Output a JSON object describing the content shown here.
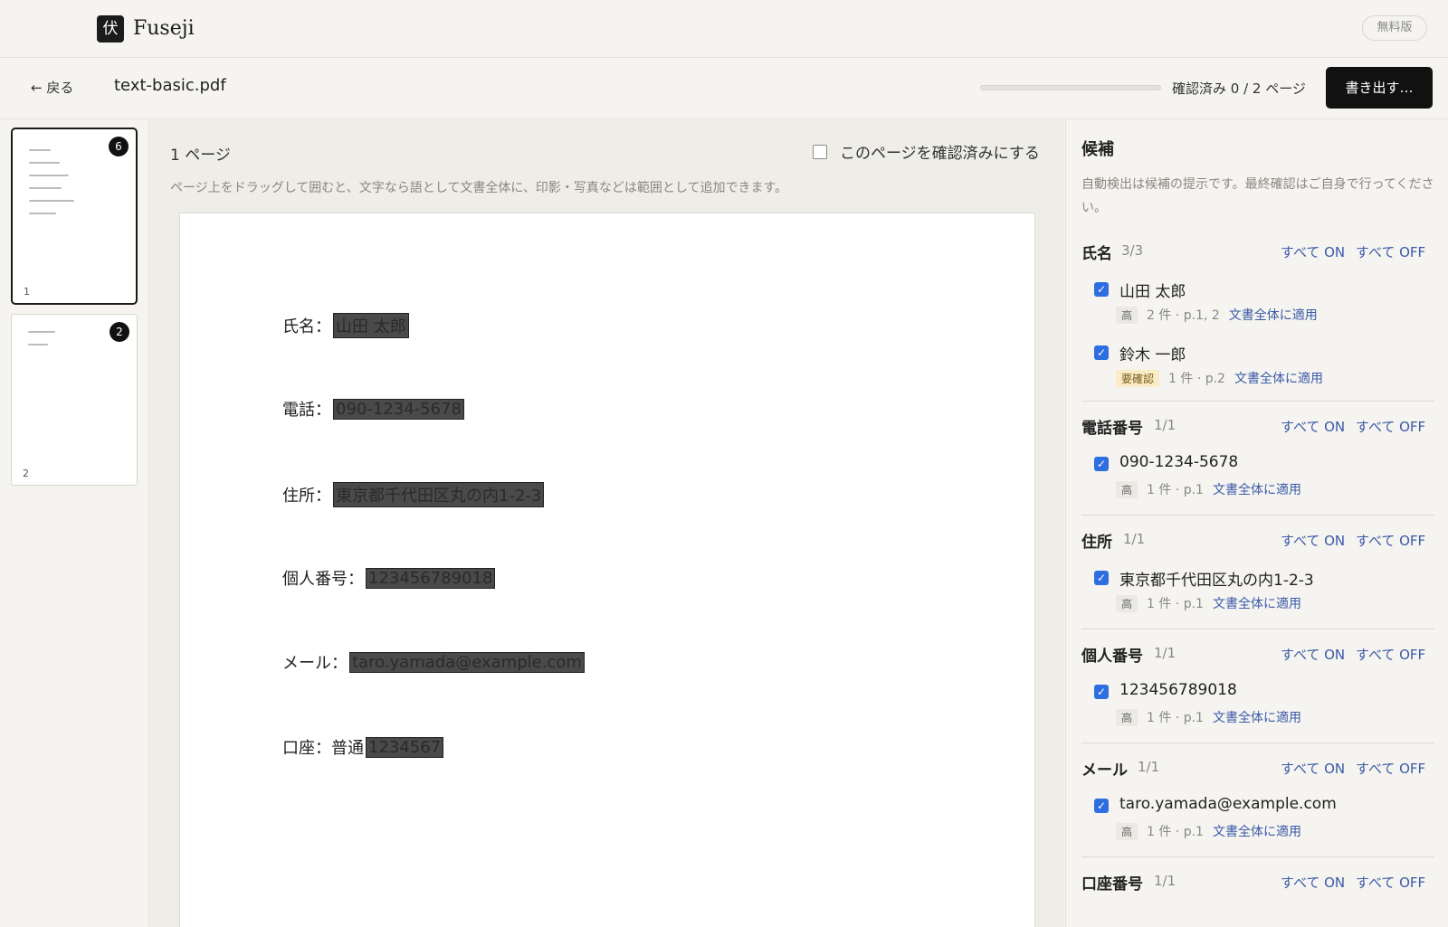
{
  "app": {
    "logo_glyph": "伏",
    "name": "Fuseji",
    "plan_badge": "無料版"
  },
  "toolbar": {
    "back_label": "← 戻る",
    "filename": "text-basic.pdf",
    "progress_text": "確認済み 0 / 2 ページ",
    "progress_fraction": 0,
    "export_label": "書き出す…"
  },
  "thumbnails": [
    {
      "page": "1",
      "count": "6",
      "selected": true
    },
    {
      "page": "2",
      "count": "2",
      "selected": false
    }
  ],
  "viewer": {
    "page_label": "1 ページ",
    "confirm_label": "このページを確認済みにする",
    "hint": "ページ上をドラッグして囲むと、文字なら語として文書全体に、印影・写真などは範囲として追加できます。",
    "fields": [
      {
        "label": "氏名：",
        "value": "山田 太郎"
      },
      {
        "label": "電話：",
        "value": "090-1234-5678"
      },
      {
        "label": "住所：",
        "value": "東京都千代田区丸の内1-2-3"
      },
      {
        "label": "個人番号：",
        "value": "123456789018"
      },
      {
        "label": "メール：",
        "value": "taro.yamada@example.com"
      },
      {
        "label": "口座：普通 ",
        "value": "1234567"
      }
    ]
  },
  "panel": {
    "title": "候補",
    "note": "自動検出は候補の提示です。最終確認はご自身で行ってください。",
    "all_on": "すべて ON",
    "all_off": "すべて OFF",
    "apply_label": "文書全体に適用",
    "sections": [
      {
        "name": "氏名",
        "count": "3/3",
        "items": [
          {
            "text": "山田 太郎",
            "tag": "高",
            "meta": "2 件 · p.1, 2"
          },
          {
            "text": "鈴木 一郎",
            "tag": "要確認",
            "meta": "1 件 · p.2"
          }
        ]
      },
      {
        "name": "電話番号",
        "count": "1/1",
        "items": [
          {
            "text": "090-1234-5678",
            "tag": "高",
            "meta": "1 件 · p.1"
          }
        ]
      },
      {
        "name": "住所",
        "count": "1/1",
        "items": [
          {
            "text": "東京都千代田区丸の内1-2-3",
            "tag": "高",
            "meta": "1 件 · p.1"
          }
        ]
      },
      {
        "name": "個人番号",
        "count": "1/1",
        "items": [
          {
            "text": "123456789018",
            "tag": "高",
            "meta": "1 件 · p.1"
          }
        ]
      },
      {
        "name": "メール",
        "count": "1/1",
        "items": [
          {
            "text": "taro.yamada@example.com",
            "tag": "高",
            "meta": "1 件 · p.1"
          }
        ]
      },
      {
        "name": "口座番号",
        "count": "1/1",
        "items": []
      }
    ]
  },
  "colors": {
    "accent": "#2f6ee0",
    "link": "#3b5aa8",
    "warn_tag": "#faecc6",
    "export": "#111111"
  }
}
